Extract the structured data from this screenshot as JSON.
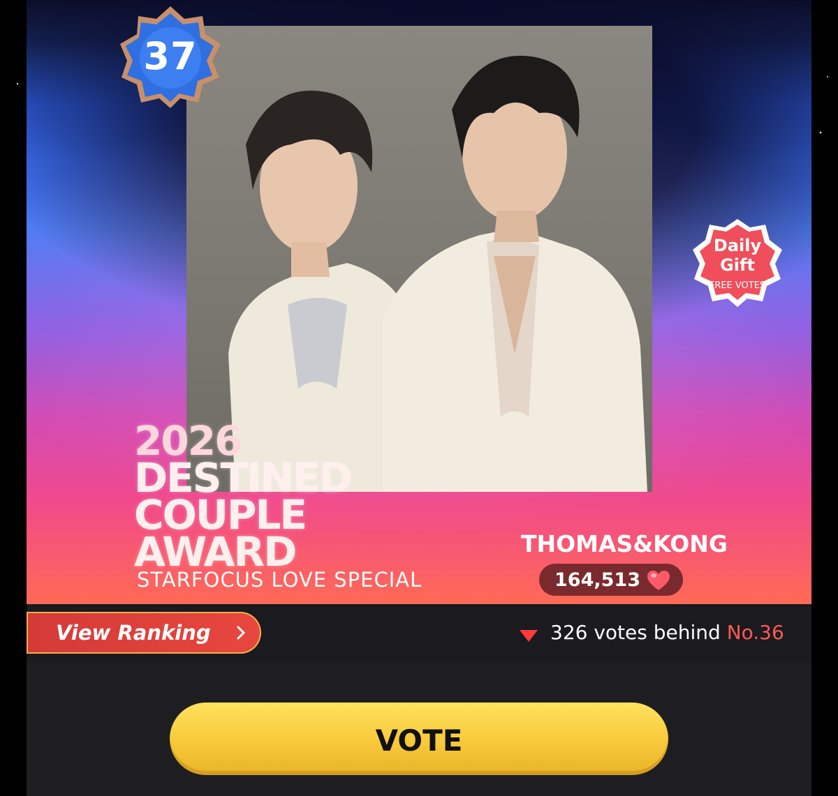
{
  "card": {
    "rank_number": "37",
    "award_title_lines": [
      "2026",
      "DESTINED",
      "COUPLE",
      "AWARD"
    ],
    "award_subtitle": "STARFOCUS LOVE SPECIAL",
    "couple_name": "THOMAS&KONG",
    "vote_count": "164,513",
    "daily_gift": {
      "line1": "Daily",
      "line2": "Gift",
      "line3": "FREE VOTES"
    }
  },
  "ranking_bar": {
    "view_ranking_label": "View Ranking",
    "behind_text": "326 votes behind ",
    "behind_rank": "No.36"
  },
  "vote_button_label": "VOTE",
  "colors": {
    "vote_button": "#f7c93a",
    "view_ranking_bg": "#d43a38",
    "rank_highlight": "#ff5a52",
    "heart": "#ff5a6a",
    "badge_blue": "#2f6fe0"
  },
  "icons": [
    "star-badge-icon",
    "heart-icon",
    "chevron-right-icon",
    "down-triangle-icon",
    "gift-badge-icon"
  ]
}
